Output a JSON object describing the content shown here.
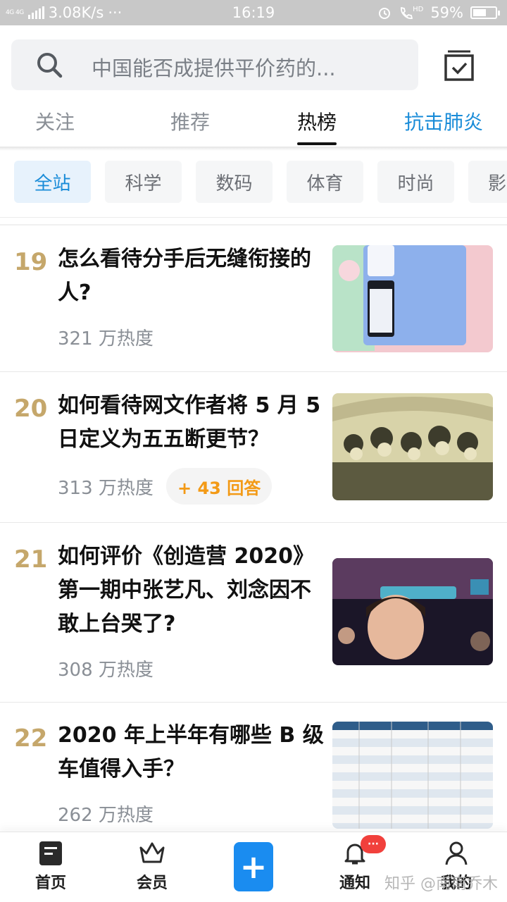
{
  "status_bar": {
    "network": "4G 4G",
    "speed": "3.08K/s",
    "dots": "···",
    "time": "16:19",
    "hd": "HD",
    "battery_percent": "59%",
    "battery_level": 0.59
  },
  "search": {
    "placeholder": "中国能否成提供平价药的..."
  },
  "tabs": [
    {
      "label": "关注"
    },
    {
      "label": "推荐"
    },
    {
      "label": "热榜"
    },
    {
      "label": "抗击肺炎"
    }
  ],
  "active_tab": "热榜",
  "categories": [
    {
      "label": "全站"
    },
    {
      "label": "科学"
    },
    {
      "label": "数码"
    },
    {
      "label": "体育"
    },
    {
      "label": "时尚"
    },
    {
      "label": "影"
    }
  ],
  "items": [
    {
      "rank": "19",
      "title": "怎么看待分手后无缝衔接的人?",
      "heat": "321 万热度",
      "badge": ""
    },
    {
      "rank": "20",
      "title": "如何看待网文作者将 5 月 5 日定义为五五断更节？",
      "heat": "313 万热度",
      "badge": "+ 43 回答"
    },
    {
      "rank": "21",
      "title": "如何评价《创造营 2020》第一期中张艺凡、刘念因不敢上台哭了?",
      "heat": "308 万热度",
      "badge": ""
    },
    {
      "rank": "22",
      "title": "2020 年上半年有哪些 B 级车值得入手？",
      "heat": "262 万热度",
      "badge": ""
    }
  ],
  "bottom_nav": {
    "home": "首页",
    "vip": "会员",
    "notify": "通知",
    "notify_badge": "···",
    "me": "我的"
  },
  "watermark": "知乎 @南南乔木",
  "colors": {
    "accent": "#1a8cd8",
    "rank": "#c5a76b",
    "badge_text": "#f39a16",
    "plus_button": "#1a8cf0"
  }
}
